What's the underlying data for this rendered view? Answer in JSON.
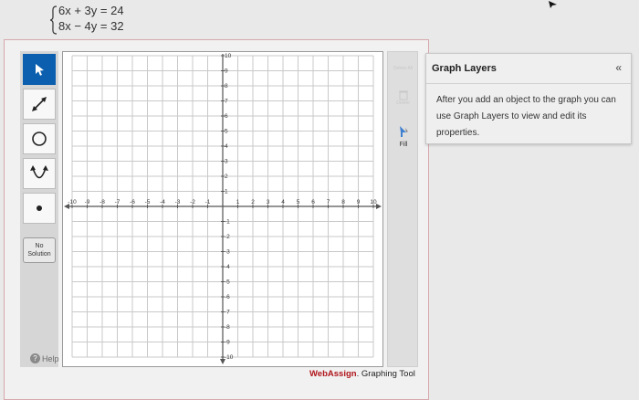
{
  "problem": {
    "equation_1": "6x + 3y  =  24",
    "equation_2": "8x − 4y  =  32"
  },
  "toolbar": {
    "tools": [
      {
        "name": "select-arrow",
        "active": true
      },
      {
        "name": "line-segment"
      },
      {
        "name": "circle"
      },
      {
        "name": "parabola"
      },
      {
        "name": "point"
      }
    ],
    "no_solution_line1": "No",
    "no_solution_line2": "Solution",
    "help_label": "Help"
  },
  "graph": {
    "x_range": [
      -10,
      10
    ],
    "y_range": [
      -10,
      10
    ],
    "x_tick_labels": [
      "-10",
      "-9",
      "-8",
      "-7",
      "-6",
      "-5",
      "-4",
      "-3",
      "-2",
      "-1",
      "1",
      "2",
      "3",
      "4",
      "5",
      "6",
      "7",
      "8",
      "9",
      "10"
    ],
    "y_tick_labels": [
      "10",
      "9",
      "8",
      "7",
      "6",
      "5",
      "4",
      "3",
      "2",
      "1",
      "-1",
      "-2",
      "-3",
      "-4",
      "-5",
      "-6",
      "-7",
      "-8",
      "-9",
      "-10"
    ]
  },
  "side_panel": {
    "top_label": "Delete All",
    "delete_label": "Delete",
    "fill_label": "Fill"
  },
  "branding": {
    "brand_prefix": "Web",
    "brand_highlight": "Assign",
    "brand_suffix": ". Graphing Tool"
  },
  "graph_layers": {
    "title": "Graph Layers",
    "collapse_icon": "«",
    "description": "After you add an object to the graph you can use Graph Layers to view and edit its properties."
  },
  "colors": {
    "active_tool": "#0b5fae",
    "brand_red": "#b0151b",
    "fill_arrow": "#3f7fd0"
  }
}
